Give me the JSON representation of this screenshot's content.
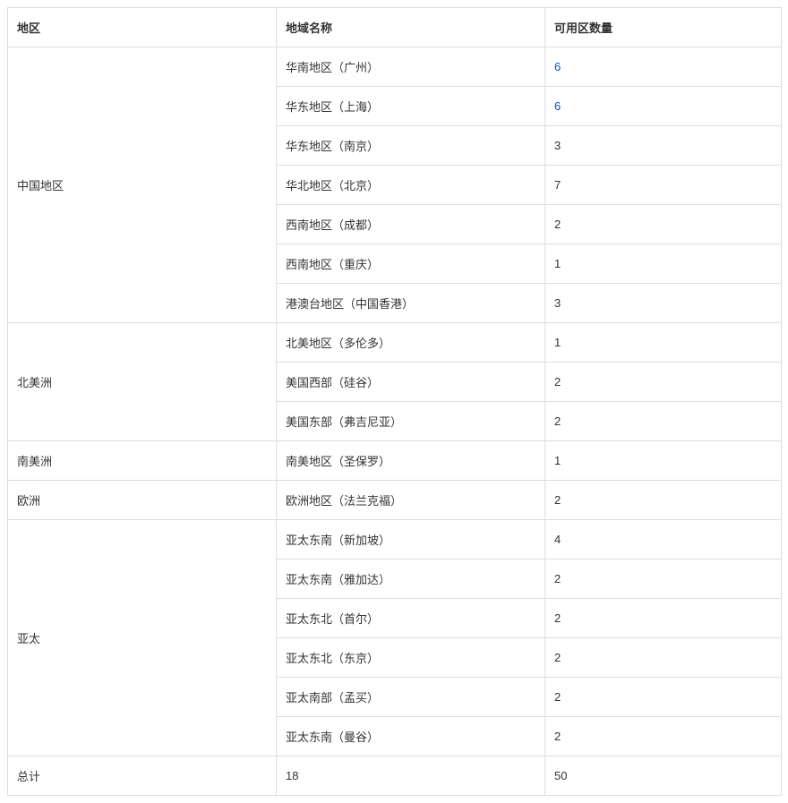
{
  "headers": {
    "area": "地区",
    "region": "地域名称",
    "azcount": "可用区数量"
  },
  "groups": [
    {
      "area": "中国地区",
      "rows": [
        {
          "region": "华南地区（广州）",
          "azcount": "6",
          "link": true
        },
        {
          "region": "华东地区（上海）",
          "azcount": "6",
          "link": true
        },
        {
          "region": "华东地区（南京）",
          "azcount": "3",
          "link": false
        },
        {
          "region": "华北地区（北京）",
          "azcount": "7",
          "link": false
        },
        {
          "region": "西南地区（成都）",
          "azcount": "2",
          "link": false
        },
        {
          "region": "西南地区（重庆）",
          "azcount": "1",
          "link": false
        },
        {
          "region": "港澳台地区（中国香港）",
          "azcount": "3",
          "link": false
        }
      ]
    },
    {
      "area": "北美洲",
      "rows": [
        {
          "region": "北美地区（多伦多）",
          "azcount": "1",
          "link": false
        },
        {
          "region": "美国西部（硅谷）",
          "azcount": "2",
          "link": false
        },
        {
          "region": "美国东部（弗吉尼亚）",
          "azcount": "2",
          "link": false
        }
      ]
    },
    {
      "area": "南美洲",
      "rows": [
        {
          "region": "南美地区（圣保罗）",
          "azcount": "1",
          "link": false
        }
      ]
    },
    {
      "area": "欧洲",
      "rows": [
        {
          "region": "欧洲地区（法兰克福）",
          "azcount": "2",
          "link": false
        }
      ]
    },
    {
      "area": "亚太",
      "rows": [
        {
          "region": "亚太东南（新加坡）",
          "azcount": "4",
          "link": false
        },
        {
          "region": "亚太东南（雅加达）",
          "azcount": "2",
          "link": false
        },
        {
          "region": "亚太东北（首尔）",
          "azcount": "2",
          "link": false
        },
        {
          "region": "亚太东北（东京）",
          "azcount": "2",
          "link": false
        },
        {
          "region": "亚太南部（孟买）",
          "azcount": "2",
          "link": false
        },
        {
          "region": "亚太东南（曼谷）",
          "azcount": "2",
          "link": false
        }
      ]
    }
  ],
  "total": {
    "label": "总计",
    "regions": "18",
    "azcount": "50"
  }
}
